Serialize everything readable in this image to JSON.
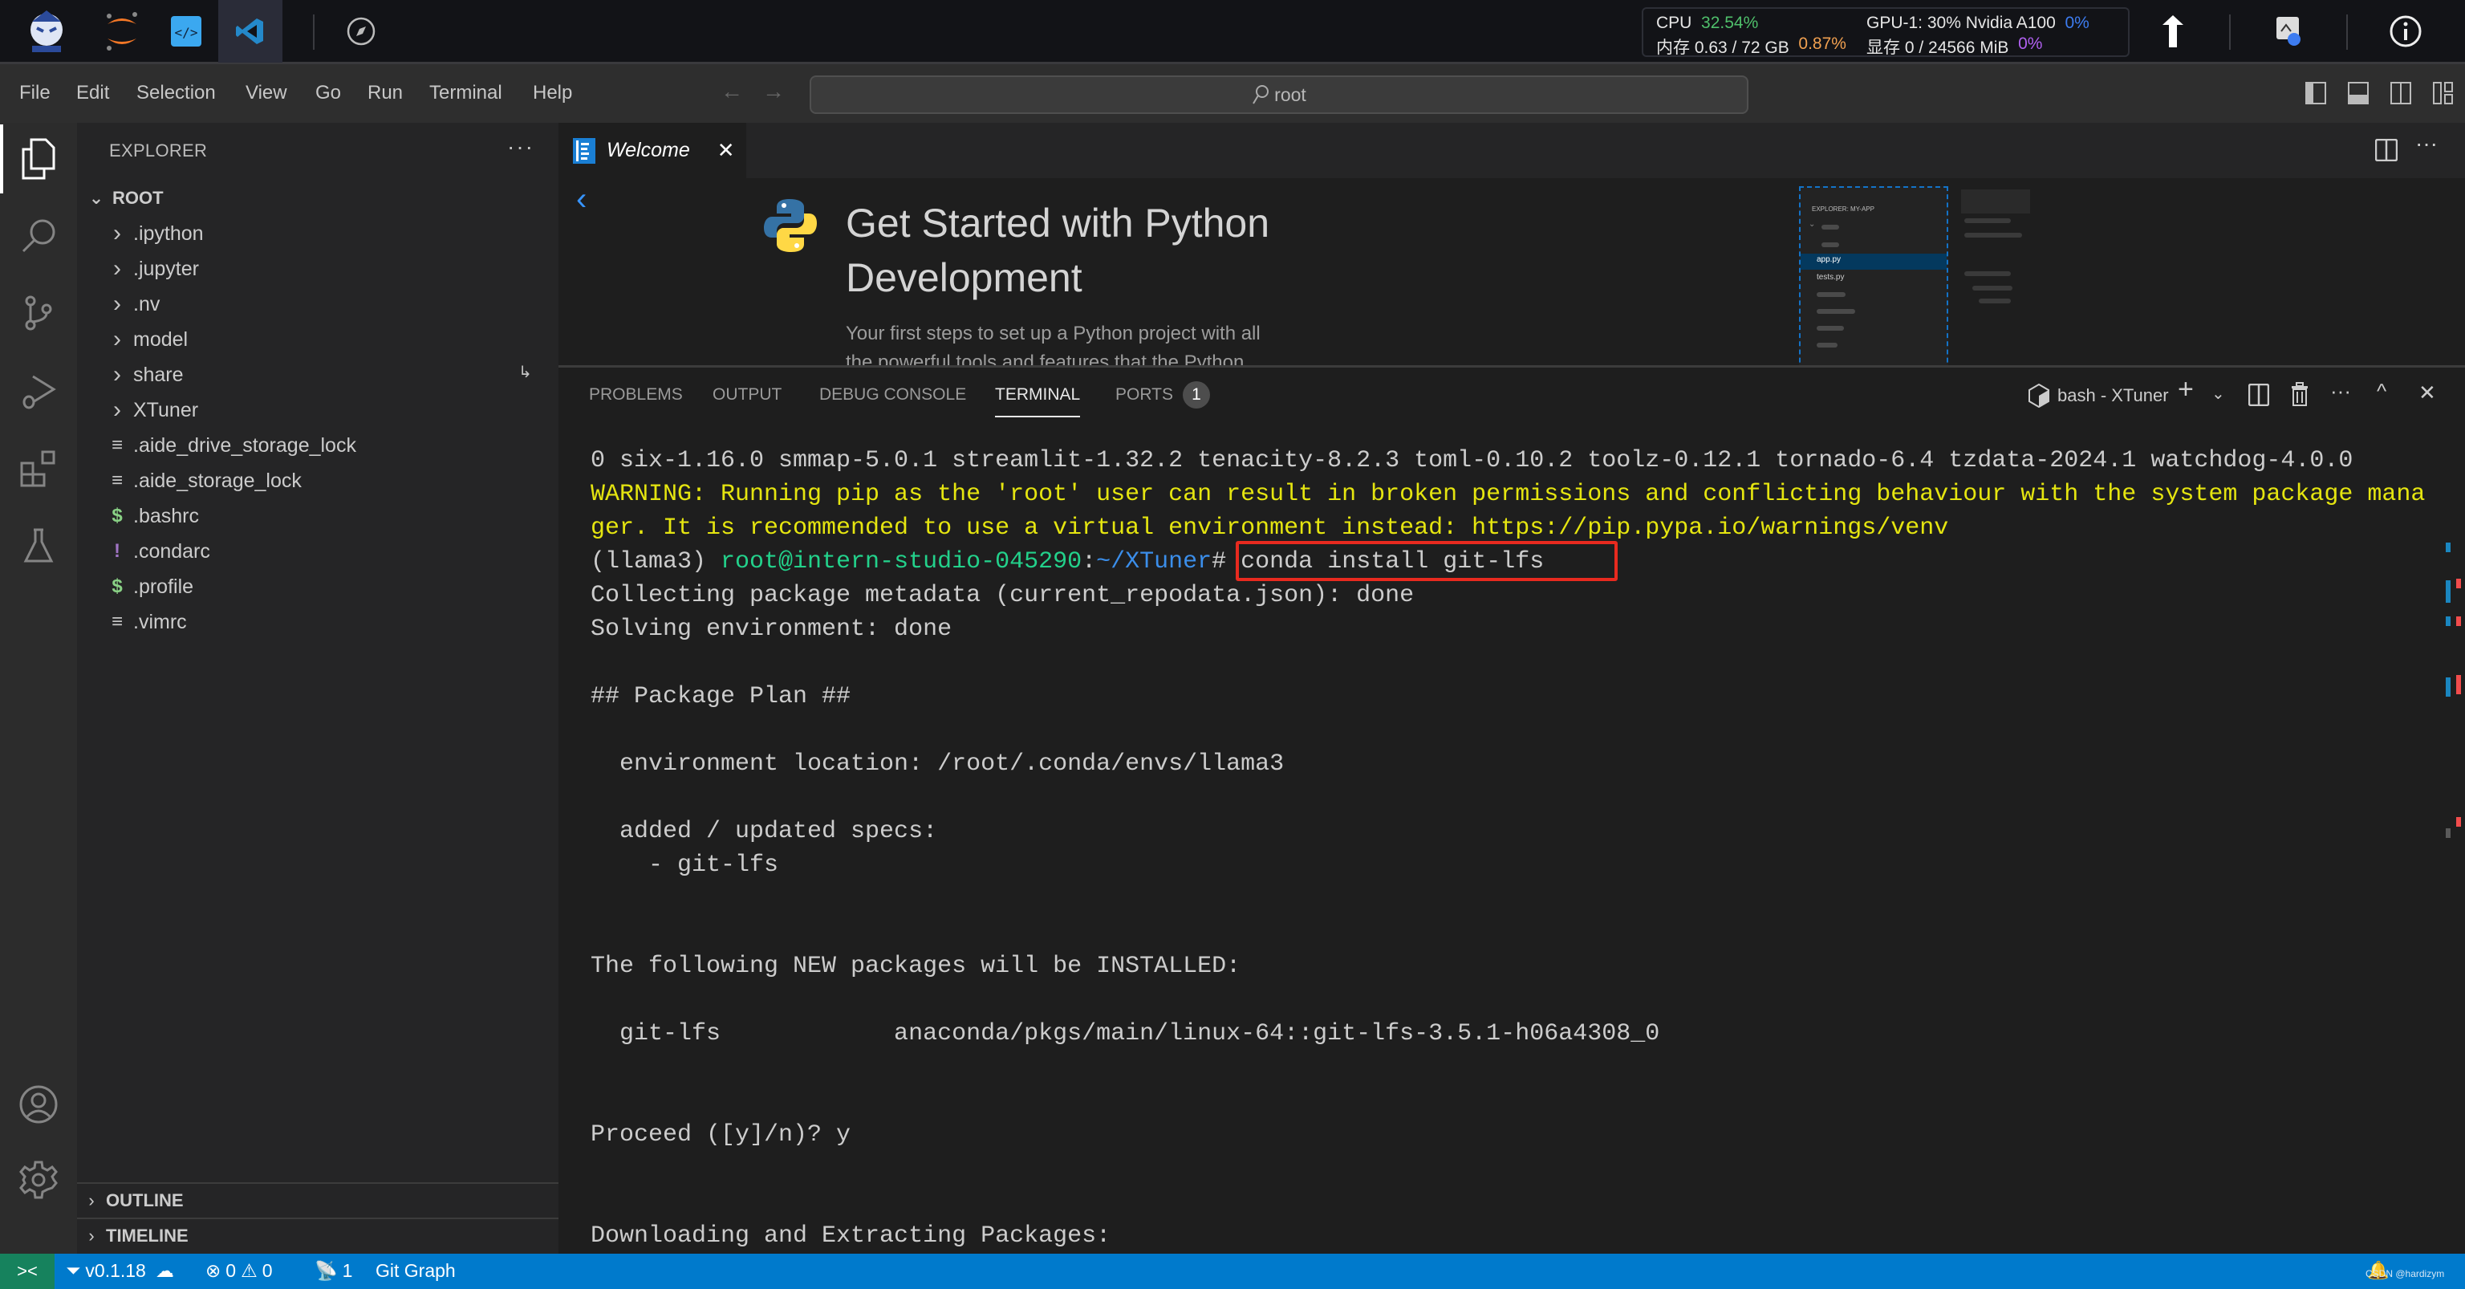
{
  "topbar": {
    "apps": [
      {
        "name": "intern-studio-logo"
      },
      {
        "name": "jupyter"
      },
      {
        "name": "code-editor"
      },
      {
        "name": "vscode",
        "active": true
      },
      {
        "name": "compass"
      }
    ],
    "sysmon": {
      "cpu_label": "CPU",
      "cpu_value": "32.54%",
      "mem_label": "内存 0.63 / 72 GB",
      "mem_value": "0.87%",
      "gpu_label": "GPU-1: 30% Nvidia A100",
      "gpu_value": "0%",
      "vram_label": "显存 0 / 24566 MiB",
      "vram_value": "0%"
    }
  },
  "menubar": {
    "items": [
      "File",
      "Edit",
      "Selection",
      "View",
      "Go",
      "Run",
      "Terminal",
      "Help"
    ],
    "search_text": "root"
  },
  "sidebar": {
    "title": "EXPLORER",
    "root_label": "ROOT",
    "items": [
      {
        "label": ".ipython",
        "type": "folder"
      },
      {
        "label": ".jupyter",
        "type": "folder"
      },
      {
        "label": ".nv",
        "type": "folder"
      },
      {
        "label": "model",
        "type": "folder"
      },
      {
        "label": "share",
        "type": "folder"
      },
      {
        "label": "XTuner",
        "type": "folder"
      },
      {
        "label": ".aide_drive_storage_lock",
        "type": "file",
        "icon": "≡"
      },
      {
        "label": ".aide_storage_lock",
        "type": "file",
        "icon": "≡"
      },
      {
        "label": ".bashrc",
        "type": "file",
        "icon": "$"
      },
      {
        "label": ".condarc",
        "type": "file",
        "icon": "!"
      },
      {
        "label": ".profile",
        "type": "file",
        "icon": "$"
      },
      {
        "label": ".vimrc",
        "type": "file",
        "icon": "≡"
      }
    ],
    "sections": [
      "OUTLINE",
      "TIMELINE"
    ]
  },
  "editor": {
    "tab_label": "Welcome",
    "welcome_title_line1": "Get Started with Python",
    "welcome_title_line2": "Development",
    "welcome_desc_line1": "Your first steps to set up a Python project with all",
    "welcome_desc_line2": "the powerful tools and features that the Python",
    "preview": {
      "header": "EXPLORER: MY-APP",
      "files": [
        "app.py",
        "tests.py"
      ]
    }
  },
  "panel": {
    "tabs": [
      "PROBLEMS",
      "OUTPUT",
      "DEBUG CONSOLE",
      "TERMINAL",
      "PORTS"
    ],
    "active_tab": "TERMINAL",
    "ports_badge": "1",
    "terminal_name": "bash - XTuner"
  },
  "terminal": {
    "lines": [
      {
        "text": "0 six-1.16.0 smmap-5.0.1 streamlit-1.32.2 tenacity-8.2.3 toml-0.10.2 toolz-0.12.1 tornado-6.4 tzdata-2024.1 watchdog-4.0.0",
        "color": "default"
      },
      {
        "text": "WARNING: Running pip as the 'root' user can result in broken permissions and conflicting behaviour with the system package mana",
        "color": "yellow"
      },
      {
        "text": "ger. It is recommended to use a virtual environment instead: https://pip.pypa.io/warnings/venv",
        "color": "yellow"
      },
      {
        "prompt_env": "(llama3) ",
        "prompt_user": "root@intern-studio-045290",
        "prompt_sep": ":",
        "prompt_path": "~/XTuner",
        "prompt_end": "# ",
        "command": "conda install git-lfs"
      },
      {
        "text": "Collecting package metadata (current_repodata.json): done",
        "color": "default"
      },
      {
        "text": "Solving environment: done",
        "color": "default"
      },
      {
        "text": "",
        "color": "default"
      },
      {
        "text": "## Package Plan ##",
        "color": "default"
      },
      {
        "text": "",
        "color": "default"
      },
      {
        "text": "  environment location: /root/.conda/envs/llama3",
        "color": "default"
      },
      {
        "text": "",
        "color": "default"
      },
      {
        "text": "  added / updated specs:",
        "color": "default"
      },
      {
        "text": "    - git-lfs",
        "color": "default"
      },
      {
        "text": "",
        "color": "default"
      },
      {
        "text": "",
        "color": "default"
      },
      {
        "text": "The following NEW packages will be INSTALLED:",
        "color": "default"
      },
      {
        "text": "",
        "color": "default"
      },
      {
        "text": "  git-lfs            anaconda/pkgs/main/linux-64::git-lfs-3.5.1-h06a4308_0",
        "color": "default"
      },
      {
        "text": "",
        "color": "default"
      },
      {
        "text": "",
        "color": "default"
      },
      {
        "text": "Proceed ([y]/n)? y",
        "color": "default"
      },
      {
        "text": "",
        "color": "default"
      },
      {
        "text": "",
        "color": "default"
      },
      {
        "text": "Downloading and Extracting Packages:",
        "color": "default"
      }
    ]
  },
  "statusbar": {
    "version": "v0.1.18",
    "errors": "0",
    "warnings": "0",
    "ports": "1",
    "git_graph": "Git Graph",
    "watermark": "CSDN @hardizym"
  },
  "colors": {
    "accent": "#007acc",
    "remote": "#16825d",
    "highlight_box": "#e82a1f",
    "warning_text": "#e5e510",
    "prompt_user": "#23d18b",
    "prompt_path": "#3b8eea"
  }
}
